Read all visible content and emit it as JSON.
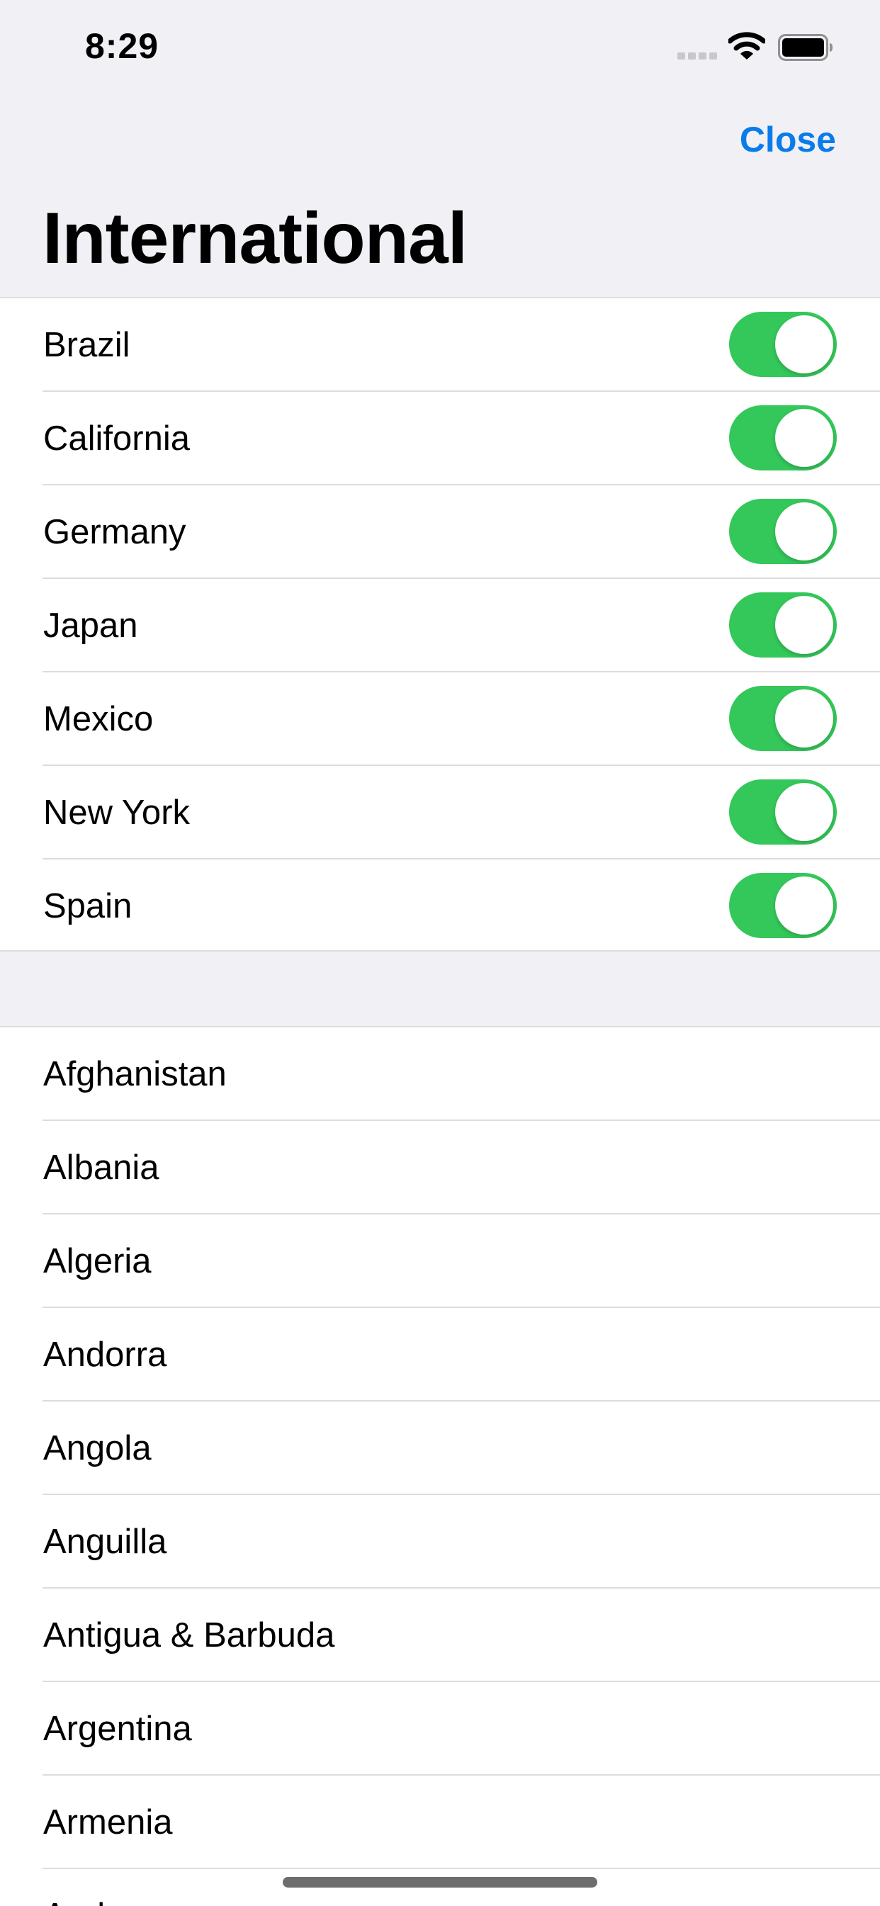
{
  "status_bar": {
    "time": "8:29"
  },
  "nav": {
    "close_label": "Close",
    "title": "International"
  },
  "colors": {
    "accent": "#0a7bea",
    "toggle_on": "#34c759"
  },
  "toggles": [
    {
      "label": "Brazil",
      "on": true
    },
    {
      "label": "California",
      "on": true
    },
    {
      "label": "Germany",
      "on": true
    },
    {
      "label": "Japan",
      "on": true
    },
    {
      "label": "Mexico",
      "on": true
    },
    {
      "label": "New York",
      "on": true
    },
    {
      "label": "Spain",
      "on": true
    }
  ],
  "countries": [
    {
      "label": "Afghanistan"
    },
    {
      "label": "Albania"
    },
    {
      "label": "Algeria"
    },
    {
      "label": "Andorra"
    },
    {
      "label": "Angola"
    },
    {
      "label": "Anguilla"
    },
    {
      "label": "Antigua & Barbuda"
    },
    {
      "label": "Argentina"
    },
    {
      "label": "Armenia"
    },
    {
      "label": "Aruba"
    }
  ]
}
